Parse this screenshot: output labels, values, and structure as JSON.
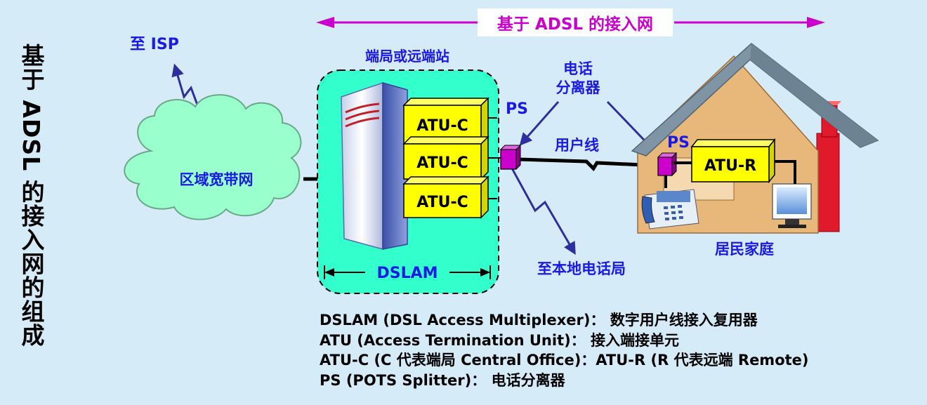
{
  "side_title": "基于 ADSL 的接入网的组成",
  "top_banner": "基于 ADSL 的接入网",
  "labels": {
    "to_isp": "至 ISP",
    "cloud": "区域宽带网",
    "central_station": "端局或远端站",
    "dslam": "DSLAM",
    "atu_c": [
      "ATU-C",
      "ATU-C",
      "ATU-C"
    ],
    "ps_left": "PS",
    "splitter_line1": "电话",
    "splitter_line2": "分离器",
    "user_line": "用户线",
    "ps_right": "PS",
    "atu_r": "ATU-R",
    "to_local_office": "至本地电话局",
    "home": "居民家庭"
  },
  "legend": [
    "DSLAM (DSL Access Multiplexer)： 数字用户线接入复用器",
    "ATU (Access Termination Unit)： 接入端接单元",
    "ATU-C (C 代表端局 Central Office)：ATU-R (R 代表远端 Remote)",
    "PS (POTS Splitter)： 电话分离器"
  ],
  "colors": {
    "background": "#d6ebf8",
    "blue_text": "#1a1ae6",
    "magenta": "#cc00cc",
    "atu_yellow": "#ffff00",
    "dslam_box": "#33ffcc",
    "cloud": "#99ffcc",
    "roof": "#7f95a6",
    "house_wall": "#e8b87a"
  }
}
